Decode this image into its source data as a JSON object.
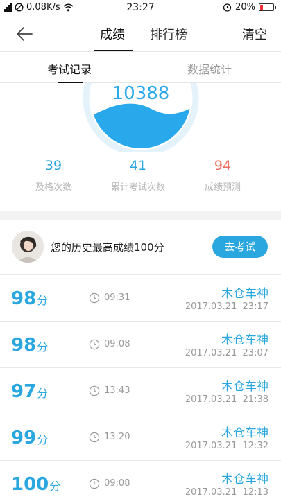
{
  "status_bar": {
    "speed": "0.08K/s",
    "time": "23:27",
    "battery": "20%"
  },
  "nav": {
    "tabs": [
      {
        "label": "成绩",
        "active": true
      },
      {
        "label": "排行榜",
        "active": false
      }
    ],
    "clear_label": "清空"
  },
  "sub_tabs": [
    {
      "label": "考试记录",
      "active": true
    },
    {
      "label": "数据统计",
      "active": false
    }
  ],
  "gauge": {
    "value": "10388"
  },
  "stats": [
    {
      "value": "39",
      "label": "及格次数",
      "color": "#2ba7e0"
    },
    {
      "value": "41",
      "label": "累计考试次数",
      "color": "#2ba7e0"
    },
    {
      "value": "94",
      "label": "成绩预测",
      "color": "#ef6b5e"
    }
  ],
  "best": {
    "text": "您的历史最高成绩100分",
    "button_label": "去考试"
  },
  "records": [
    {
      "score": "98",
      "unit": "分",
      "duration": "09:31",
      "name": "木仓车神",
      "datetime": "2017.03.21  23:17"
    },
    {
      "score": "98",
      "unit": "分",
      "duration": "09:08",
      "name": "木仓车神",
      "datetime": "2017.03.21  23:07"
    },
    {
      "score": "97",
      "unit": "分",
      "duration": "13:43",
      "name": "木仓车神",
      "datetime": "2017.03.21  21:38"
    },
    {
      "score": "99",
      "unit": "分",
      "duration": "13:20",
      "name": "木仓车神",
      "datetime": "2017.03.21  12:32"
    },
    {
      "score": "100",
      "unit": "分",
      "duration": "09:08",
      "name": "木仓车神",
      "datetime": "2017.03.21  12:13"
    }
  ],
  "colors": {
    "accent": "#2ba7e0",
    "prediction": "#ef6b5e"
  }
}
